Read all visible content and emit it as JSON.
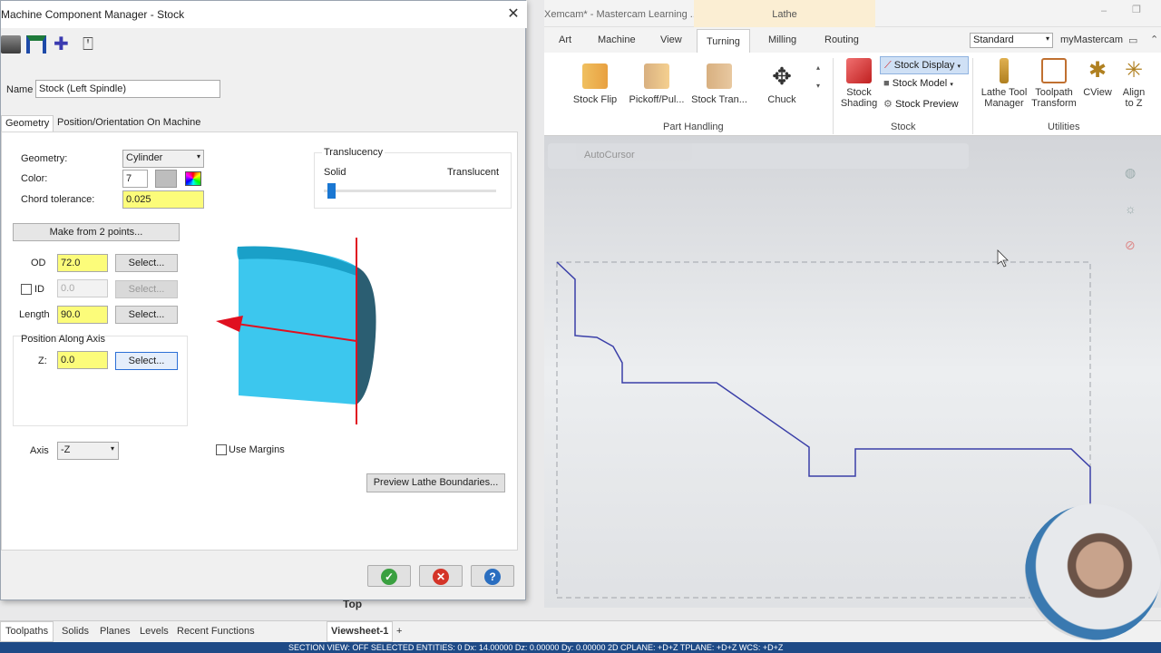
{
  "window_title_partial": "Xemcam* - Mastercam Learning ...",
  "context_tab": "Lathe",
  "ribbon_tabs": [
    "Art",
    "Machine",
    "View",
    "Turning",
    "Milling",
    "Routing"
  ],
  "active_tab": "Turning",
  "style_select": "Standard",
  "account": "myMastercam",
  "ribbon": {
    "part_handling": {
      "label": "Part Handling",
      "buttons": [
        "Stock Flip",
        "Pickoff/Pul...",
        "Stock Tran...",
        "Chuck"
      ]
    },
    "stock": {
      "label": "Stock",
      "shading": "Stock\nShading",
      "display": "Stock Display",
      "model": "Stock Model",
      "preview": "Stock Preview"
    },
    "utilities": {
      "label": "Utilities",
      "buttons": [
        "Lathe Tool\nManager",
        "Toolpath\nTransform",
        "CView",
        "Align\nto Z"
      ]
    }
  },
  "qa_toolbar_text": "AutoCursor",
  "viewport_label": "Top",
  "bottom_tabs": [
    "Toolpaths",
    "Solids",
    "Planes",
    "Levels",
    "Recent Functions"
  ],
  "viewsheet": "Viewsheet-1",
  "statusbar": "SECTION VIEW: OFF    SELECTED ENTITIES: 0        Dx: 14.00000    Dz: 0.00000    Dy: 0.00000    2D    CPLANE: +D+Z    TPLANE: +D+Z    WCS: +D+Z",
  "dialog": {
    "title": "Machine Component Manager - Stock",
    "name_label": "Name",
    "name_value": "Stock (Left Spindle)",
    "tabs": [
      "Geometry",
      "Position/Orientation On Machine"
    ],
    "geometry_label": "Geometry:",
    "geometry_value": "Cylinder",
    "color_label": "Color:",
    "color_value": "7",
    "chord_label": "Chord tolerance:",
    "chord_value": "0.025",
    "make_from": "Make from 2 points...",
    "od_label": "OD",
    "od_value": "72.0",
    "id_label": "ID",
    "id_value": "0.0",
    "length_label": "Length",
    "length_value": "90.0",
    "pos_axis_label": "Position Along Axis",
    "z_label": "Z:",
    "z_value": "0.0",
    "select": "Select...",
    "translucency_label": "Translucency",
    "solid": "Solid",
    "translucent": "Translucent",
    "translucency_level": 0.02,
    "axis_label": "Axis",
    "axis_value": "-Z",
    "use_margins": "Use Margins",
    "preview_btn": "Preview Lathe Boundaries..."
  }
}
